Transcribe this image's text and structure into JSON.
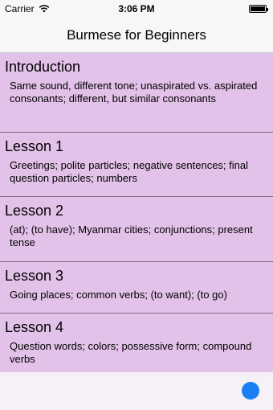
{
  "status_bar": {
    "carrier": "Carrier",
    "time": "3:06 PM",
    "battery_level": 1.0
  },
  "nav": {
    "title": "Burmese for Beginners"
  },
  "lessons": [
    {
      "title": "Introduction",
      "subtitle": "Same sound, different tone; unaspirated vs. aspirated consonants; different, but similar consonants"
    },
    {
      "title": "Lesson 1",
      "subtitle": "Greetings; polite particles; negative sentences; final question particles; numbers"
    },
    {
      "title": "Lesson 2",
      "subtitle": "(at); (to have); Myanmar cities; conjunctions; present tense"
    },
    {
      "title": "Lesson 3",
      "subtitle": "Going places; common verbs; (to want); (to go)"
    },
    {
      "title": "Lesson 4",
      "subtitle": "Question words; colors; possessive form; compound verbs"
    }
  ],
  "colors": {
    "row_bg": "#e3c2e9",
    "fab": "#1a7ff5"
  }
}
